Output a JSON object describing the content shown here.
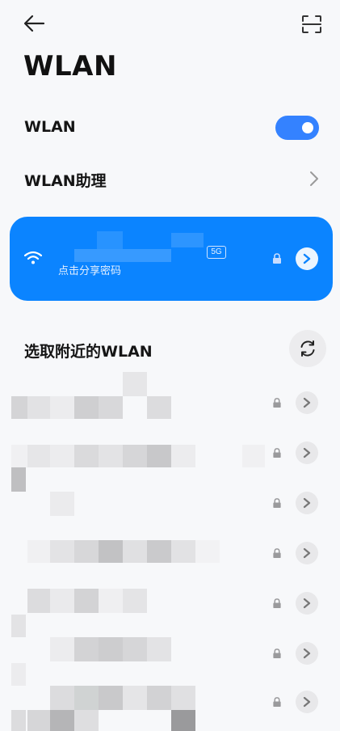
{
  "header": {
    "back_icon": "arrow-left-icon",
    "scan_icon": "scan-icon",
    "title": "WLAN"
  },
  "wlan_toggle": {
    "label": "WLAN",
    "on": true,
    "color": "#3482ff"
  },
  "assistant": {
    "label": "WLAN助理"
  },
  "connected": {
    "band": "5G",
    "subtitle": "点击分享密码",
    "bg": "#0b84ff",
    "icons": [
      "wifi-icon",
      "lock-icon",
      "chevron-right-icon"
    ]
  },
  "nearby": {
    "title": "选取附近的WLAN",
    "refresh_icon": "refresh-icon",
    "items": [
      {
        "secured": true
      },
      {
        "secured": true
      },
      {
        "secured": true
      },
      {
        "secured": true
      },
      {
        "secured": true
      },
      {
        "secured": true
      },
      {
        "secured": true
      }
    ]
  }
}
